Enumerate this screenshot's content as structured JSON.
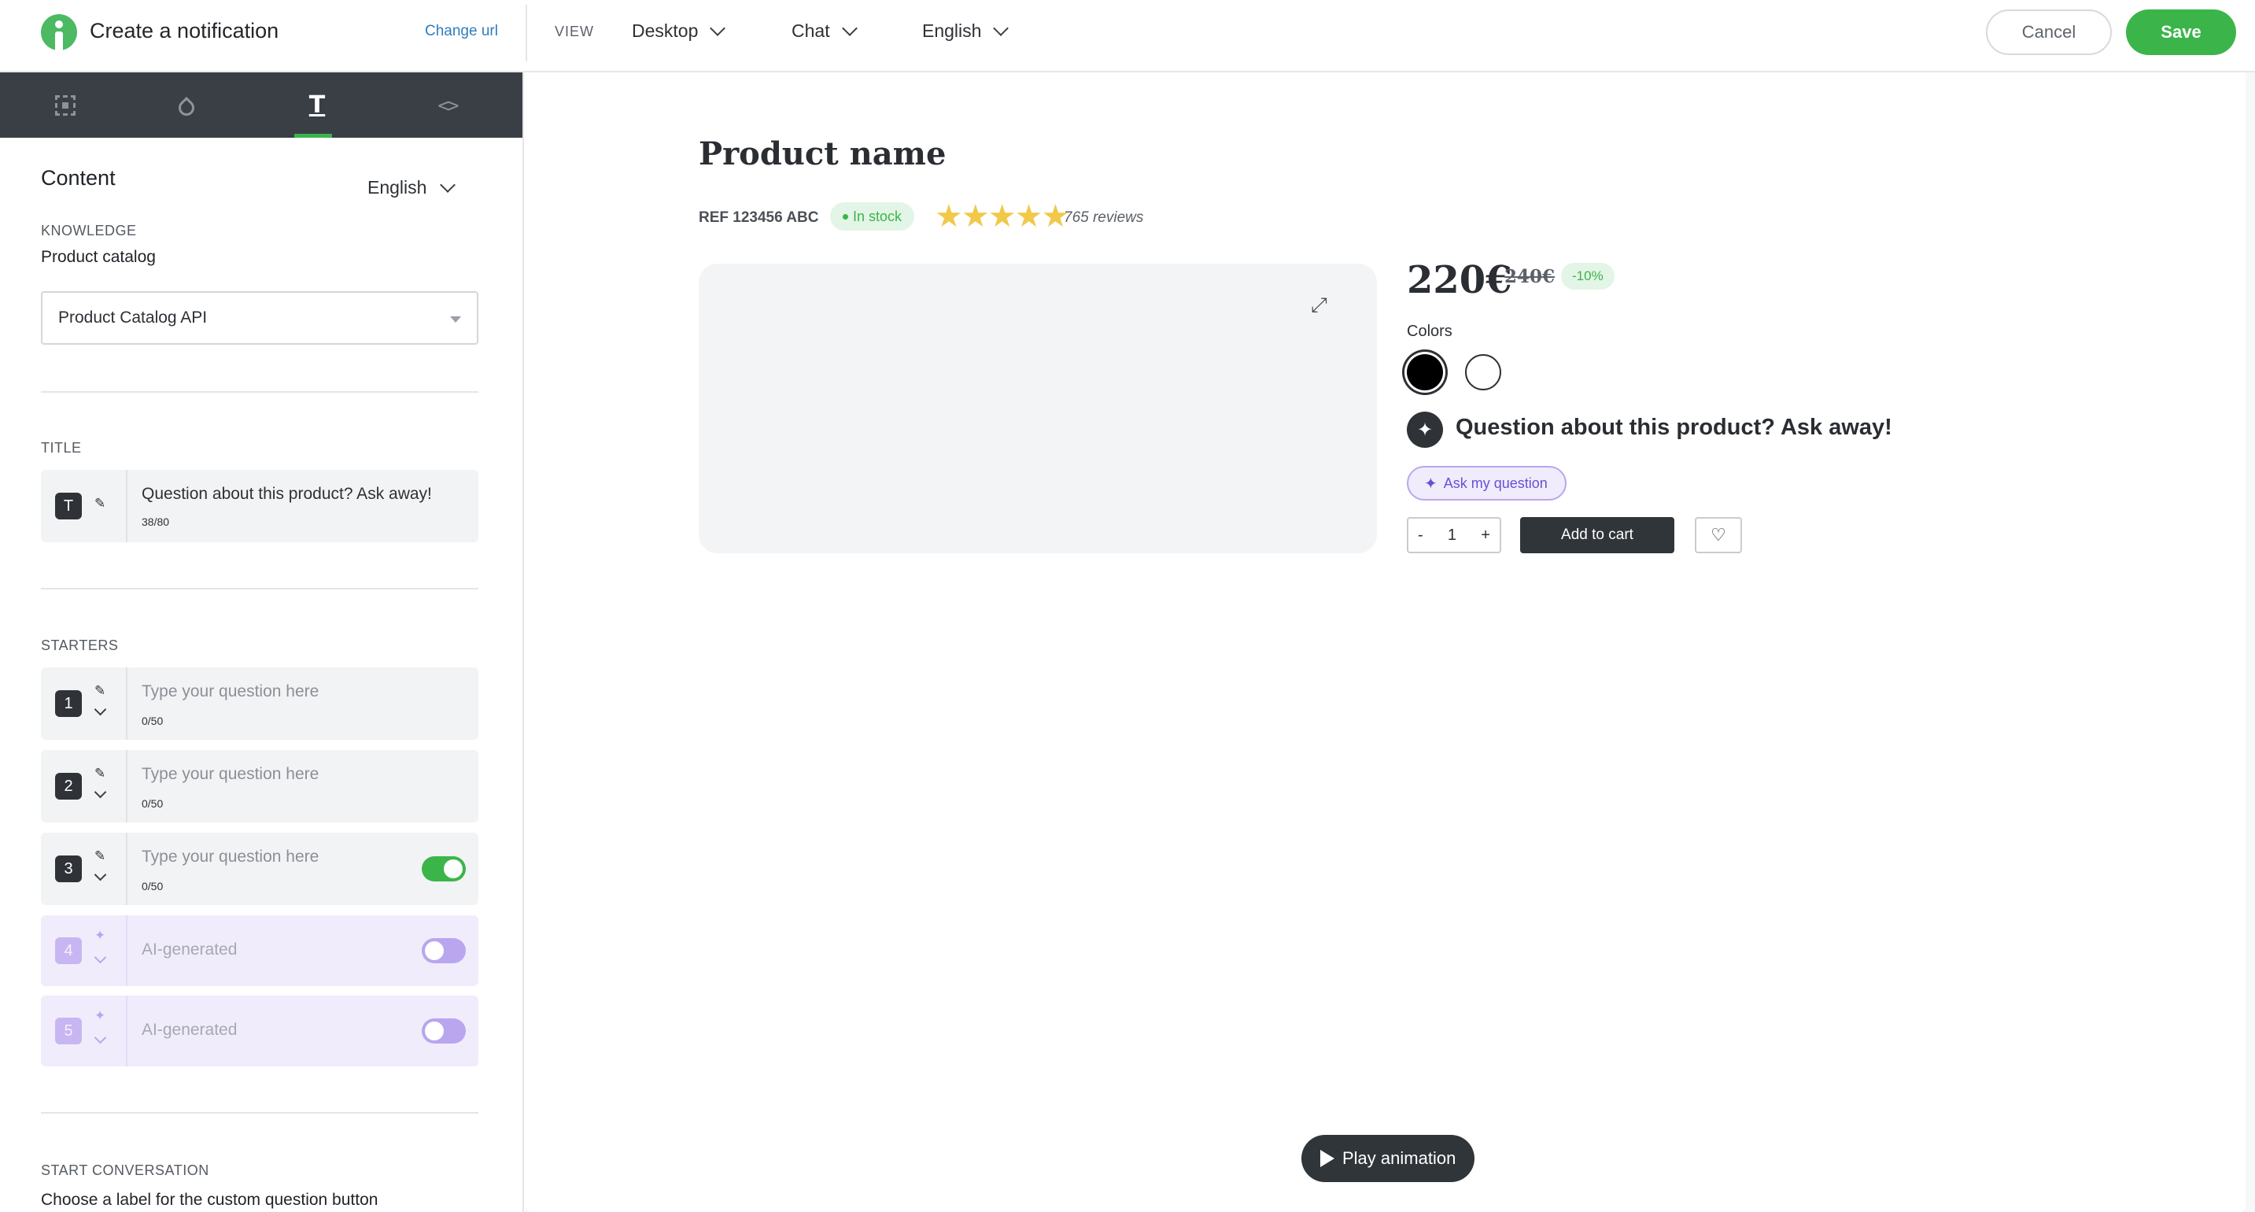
{
  "app": {
    "title": "Create a notification",
    "change_url": "Change url"
  },
  "toolbar": {
    "view_label": "VIEW",
    "device": "Desktop",
    "format": "Chat",
    "language": "English",
    "cancel": "Cancel",
    "save": "Save"
  },
  "editor_tabs": [
    {
      "icon": "frame-icon"
    },
    {
      "icon": "droplet-icon"
    },
    {
      "icon": "text-icon",
      "active": true
    },
    {
      "icon": "code-icon"
    }
  ],
  "content": {
    "heading": "Content",
    "language": "English",
    "knowledge_label": "KNOWLEDGE",
    "catalog_label": "Product catalog",
    "catalog_value": "Product Catalog API",
    "title_label": "TITLE",
    "title_badge": "T",
    "title_value": "Question about this product? Ask away!",
    "title_count": "38/80",
    "starters_label": "STARTERS",
    "starters": [
      {
        "num": "1",
        "placeholder": "Type your question here",
        "count": "0/50"
      },
      {
        "num": "2",
        "placeholder": "Type your question here",
        "count": "0/50"
      },
      {
        "num": "3",
        "placeholder": "Type your question here",
        "count": "0/50",
        "toggle": "on"
      },
      {
        "num": "4",
        "placeholder": "AI-generated",
        "toggle": "off"
      },
      {
        "num": "5",
        "placeholder": "AI-generated",
        "toggle": "off"
      }
    ],
    "start_label": "START CONVERSATION",
    "start_hint": "Choose a label for the custom question button"
  },
  "preview": {
    "product_name": "Product name",
    "ref": "REF 123456 ABC",
    "stock": "In stock",
    "stars": "★★★★★",
    "reviews": "765 reviews",
    "price": "220€",
    "old_price": "240€",
    "discount": "-10%",
    "colors_label": "Colors",
    "question": "Question about this product? Ask away!",
    "ask_button": "Ask my question",
    "qty_minus": "-",
    "qty_value": "1",
    "qty_plus": "+",
    "add_to_cart": "Add to cart",
    "play_animation": "Play animation"
  },
  "colors": {
    "accent": "#3bb54a",
    "ai_purple": "#b9a6ee",
    "dark": "#30353a"
  }
}
